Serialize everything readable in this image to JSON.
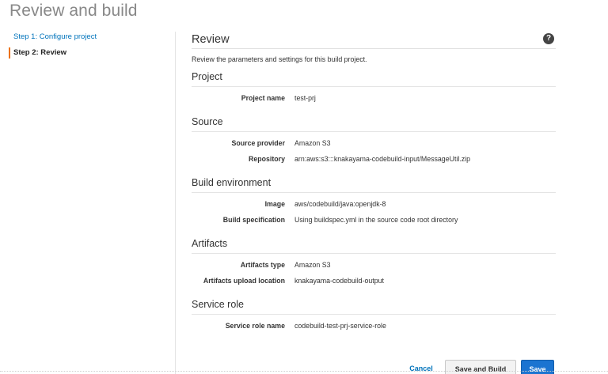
{
  "page": {
    "title": "Review and build"
  },
  "steps": [
    {
      "label": "Step 1: Configure project",
      "state": "link"
    },
    {
      "label": "Step 2: Review",
      "state": "active"
    }
  ],
  "review": {
    "title": "Review",
    "help_icon": "?",
    "description": "Review the parameters and settings for this build project."
  },
  "sections": {
    "project": {
      "title": "Project",
      "rows": [
        {
          "label": "Project name",
          "value": "test-prj"
        }
      ]
    },
    "source": {
      "title": "Source",
      "rows": [
        {
          "label": "Source provider",
          "value": "Amazon S3"
        },
        {
          "label": "Repository",
          "value": "arn:aws:s3:::knakayama-codebuild-input/MessageUtil.zip"
        }
      ]
    },
    "build_environment": {
      "title": "Build environment",
      "rows": [
        {
          "label": "Image",
          "value": "aws/codebuild/java:openjdk-8"
        },
        {
          "label": "Build specification",
          "value": "Using buildspec.yml in the source code root directory"
        }
      ]
    },
    "artifacts": {
      "title": "Artifacts",
      "rows": [
        {
          "label": "Artifacts type",
          "value": "Amazon S3"
        },
        {
          "label": "Artifacts upload location",
          "value": "knakayama-codebuild-output"
        }
      ]
    },
    "service_role": {
      "title": "Service role",
      "rows": [
        {
          "label": "Service role name",
          "value": "codebuild-test-prj-service-role"
        }
      ]
    }
  },
  "actions": {
    "cancel": "Cancel",
    "save_and_build": "Save and Build",
    "save": "Save"
  },
  "colors": {
    "accent_link": "#0073bb",
    "active_step_marker": "#ec7211",
    "primary_button": "#1b74d1"
  }
}
